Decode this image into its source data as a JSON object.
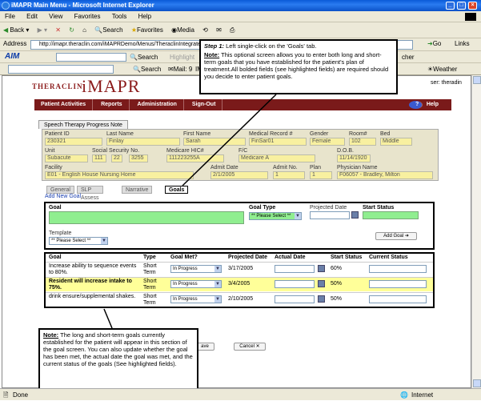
{
  "window": {
    "title": "iMAPR Main Menu - Microsoft Internet Explorer"
  },
  "menu": [
    "File",
    "Edit",
    "View",
    "Favorites",
    "Tools",
    "Help"
  ],
  "toolbar": {
    "back": "Back",
    "search": "Search",
    "favorites": "Favorites",
    "media": "Media"
  },
  "address": {
    "label": "Address",
    "url": "http://imapr.theraclin.com/iMAPRDemo/Menus/TheraclinIntegratedMenu.htm",
    "go": "Go",
    "links": "Links"
  },
  "aim": {
    "logo": "AIM",
    "search": "Search",
    "highlight": "Highlight",
    "extra": "cher"
  },
  "aim2": {
    "search": "Search",
    "mail": "Mail: 9",
    "im": "IM",
    "weather": "Weather"
  },
  "app": {
    "brand_small": "THERACLIN",
    "brand_big": "iMAPR",
    "user": "ser: theradin"
  },
  "nav": [
    "Patient Activities",
    "Reports",
    "Administration",
    "Sign-Out"
  ],
  "nav_help": "Help",
  "note_tab": "Speech Therapy Progress Note",
  "patient": {
    "labels": {
      "id": "Patient ID",
      "last": "Last Name",
      "first": "First Name",
      "mrn": "Medical Record #",
      "gender": "Gender",
      "room": "Room#",
      "bed": "Bed",
      "unit": "Unit",
      "ssn": "Social Security No.",
      "hic": "Medicare HIC#",
      "fc": "F/C",
      "dob": "D.O.B.",
      "facility": "Facility",
      "admit": "Admit Date",
      "admitno": "Admit No.",
      "plan": "Plan",
      "physician": "Physician Name"
    },
    "values": {
      "id": "230321",
      "last": "Finlay",
      "first": "Sarah",
      "mrn": "FinSar01",
      "gender": "Female",
      "room": "102",
      "bed": "Middle",
      "unit": "Subacute",
      "ssn1": "111",
      "ssn2": "22",
      "ssn3": "3255",
      "hic": "111223255A",
      "fc": "Medicare A",
      "dob": "11/14/1920",
      "facility": "E01 - English House Nursing Home",
      "admit": "2/1/2005",
      "admitno": "1",
      "plan": "1",
      "physician": "F06057 - Bradley, Milton"
    }
  },
  "tabs": [
    "General",
    "SLP Assess",
    "Narrative",
    "Goals"
  ],
  "add_new_goal": "Add New Goal",
  "new_goal": {
    "goal_label": "Goal",
    "goal_type_label": "Goal Type",
    "goal_type_value": "** Please Select **",
    "projected_label": "Projected Date",
    "start_status_label": "Start Status",
    "template_label": "Template",
    "template_value": "** Please Select **",
    "add_button": "Add Goal"
  },
  "goals_table": {
    "headers": [
      "Goal",
      "Type",
      "Goal Met?",
      "Projected Date",
      "Actual Date",
      "Start Status",
      "Current Status"
    ],
    "rows": [
      {
        "goal": "Increase ability to sequence events to 80%.",
        "type": "Short Term",
        "met": "In Progress",
        "projected": "3/17/2005",
        "start": "60%"
      },
      {
        "goal": "Resident will increase intake to 75%.",
        "type": "Short Term",
        "met": "In Progress",
        "projected": "3/4/2005",
        "start": "50%"
      },
      {
        "goal": "drink ensure/supplemental shakes.",
        "type": "Short Term",
        "met": "In Progress",
        "projected": "2/10/2005",
        "start": "50%"
      }
    ]
  },
  "buttons": {
    "save": "ave",
    "cancel": "Cancel"
  },
  "callout1": {
    "step": "Step 1:",
    "step_text": "Left single-click on the 'Goals' tab.",
    "note_label": "Note:",
    "note_text": "This optional screen allows you to enter both long and short-term goals that you have established for the patient's plan of treatment.All bolded fields (see highlighted fields) are required should you decide to enter patient goals."
  },
  "callout2": {
    "note_label": "Note:",
    "note_text": "The long and short-term goals currently established for the patient will appear in this section of the goal screen. You can also update whether the goal has been met, the actual date the goal was met, and the current status of the goals (See highlighted fields)."
  },
  "status": {
    "left": "Done",
    "zone": "Internet"
  }
}
